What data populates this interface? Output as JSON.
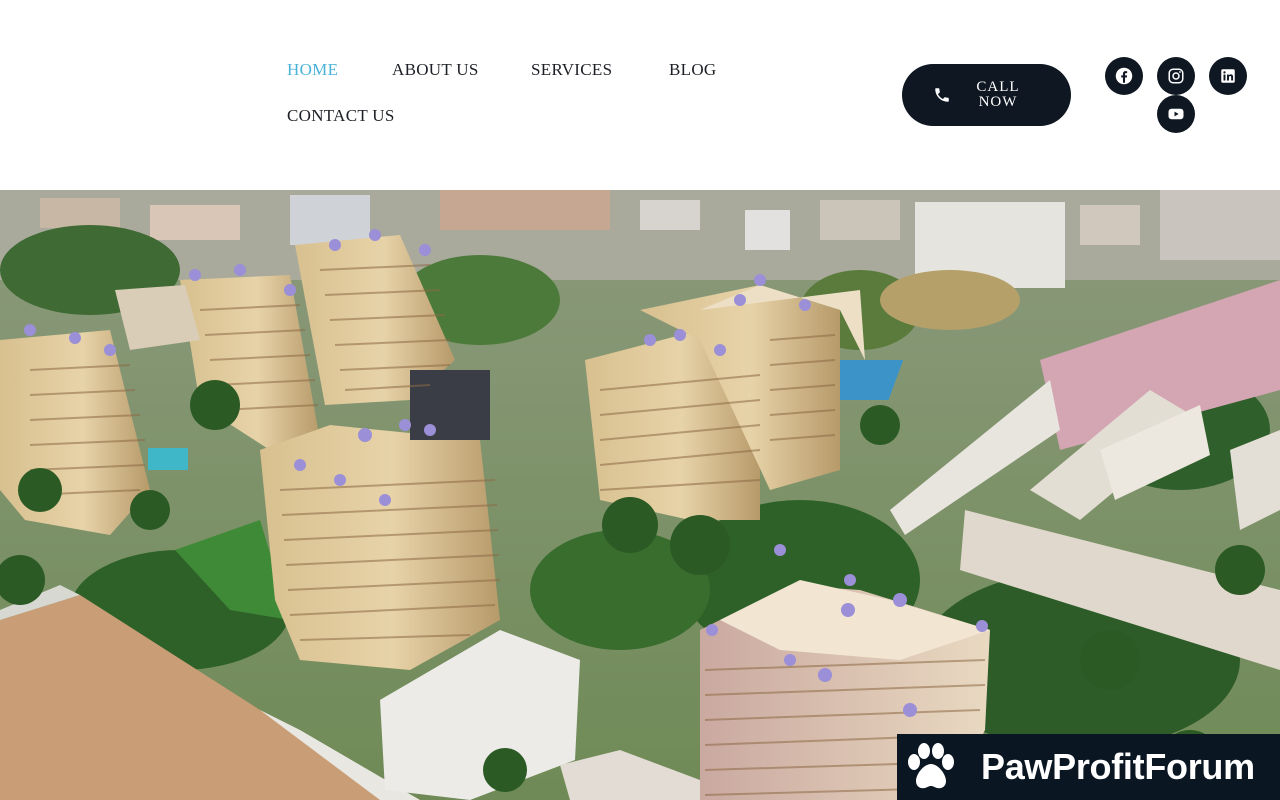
{
  "nav": {
    "items": [
      {
        "label": "HOME",
        "active": true
      },
      {
        "label": "ABOUT US",
        "active": false
      },
      {
        "label": "SERVICES",
        "active": false
      },
      {
        "label": "BLOG",
        "active": false
      },
      {
        "label": "CONTACT US",
        "active": false
      }
    ]
  },
  "cta": {
    "call_label_line1": "CALL",
    "call_label_line2": "NOW",
    "icon": "phone-icon"
  },
  "social": {
    "icons": [
      "facebook-icon",
      "instagram-icon",
      "linkedin-icon",
      "youtube-icon"
    ]
  },
  "hero": {
    "image": "aerial-view-of-residential-high-rise-apartment-towers"
  },
  "watermark": {
    "text": "PawProfitForum",
    "icon": "paw-icon"
  },
  "colors": {
    "nav_active": "#4ab3d8",
    "nav_text": "#1c1f25",
    "button_bg": "#0f1722",
    "watermark_bg": "#0b1623"
  }
}
